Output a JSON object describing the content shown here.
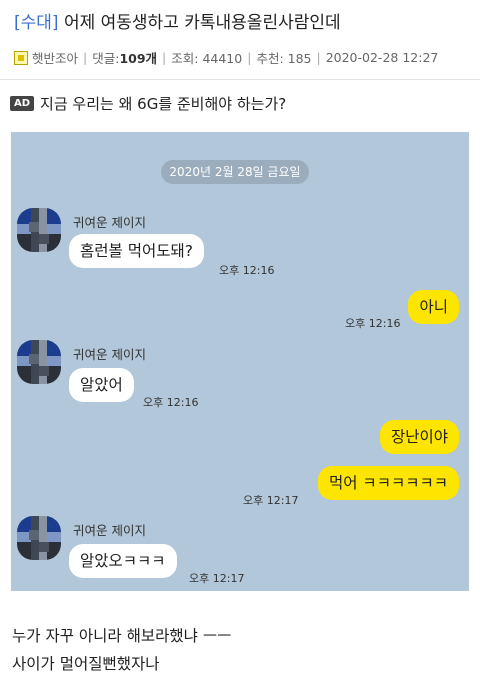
{
  "post": {
    "category": "[수대]",
    "title": "어제 여동생하고 카톡내용올린사람인데",
    "author": "햇반조아",
    "comments_label": "댓글:",
    "comments_count": "109개",
    "views": "조회: 44410",
    "recommends": "추천: 185",
    "datetime": "2020-02-28 12:27",
    "author_icon": "user-icon"
  },
  "ad": {
    "badge": "AD",
    "text": "지금 우리는 왜 6G를 준비해야 하는가?"
  },
  "chat": {
    "date_separator": "2020년 2월 28일 금요일",
    "messages": [
      {
        "sender": "귀여운 제이지",
        "text": "홈런볼 먹어도돼?",
        "time": "오후 12:16",
        "side": "left"
      },
      {
        "text": "아니",
        "time": "오후 12:16",
        "side": "right"
      },
      {
        "sender": "귀여운 제이지",
        "text": "알았어",
        "time": "오후 12:16",
        "side": "left"
      },
      {
        "text": "장난이야",
        "side": "right"
      },
      {
        "text": "먹어 ㅋㅋㅋㅋㅋㅋ",
        "time": "오후 12:17",
        "side": "right"
      },
      {
        "sender": "귀여운 제이지",
        "text": "알았오ㅋㅋㅋ",
        "time": "오후 12:17",
        "side": "left"
      }
    ],
    "colors": {
      "background": "#b2c7d9",
      "outgoing": "#fee500",
      "incoming": "#ffffff"
    }
  },
  "caption": {
    "line1": "누가 자꾸 아니라 해보라했냐 ㅡㅡ",
    "line2": "사이가 멀어질뻔했자나"
  }
}
